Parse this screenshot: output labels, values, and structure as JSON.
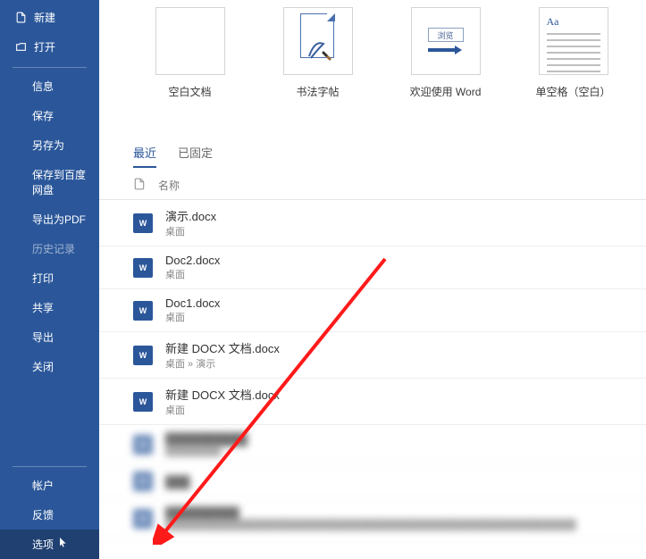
{
  "sidebar": {
    "top": [
      {
        "icon": "new-icon",
        "label": "新建"
      },
      {
        "icon": "open-icon",
        "label": "打开"
      }
    ],
    "mid": [
      {
        "label": "信息"
      },
      {
        "label": "保存"
      },
      {
        "label": "另存为"
      },
      {
        "label": "保存到百度网盘"
      },
      {
        "label": "导出为PDF"
      },
      {
        "label": "历史记录",
        "disabled": true
      },
      {
        "label": "打印"
      },
      {
        "label": "共享"
      },
      {
        "label": "导出"
      },
      {
        "label": "关闭"
      }
    ],
    "bottom": [
      {
        "label": "帐户"
      },
      {
        "label": "反馈"
      },
      {
        "label": "选项",
        "selected": true,
        "cursor": true
      }
    ]
  },
  "templates": [
    {
      "id": "blank",
      "label": "空白文档",
      "thumb": "blank"
    },
    {
      "id": "callig",
      "label": "书法字帖",
      "thumb": "callig"
    },
    {
      "id": "tour",
      "label": "欢迎使用 Word",
      "thumb": "tour",
      "tour_text": "浏览"
    },
    {
      "id": "single",
      "label": "单空格（空白）",
      "thumb": "single",
      "aa": "Aa"
    }
  ],
  "tabs": [
    {
      "id": "recent",
      "label": "最近",
      "active": true
    },
    {
      "id": "pinned",
      "label": "已固定"
    }
  ],
  "list_header": {
    "name_col": "名称"
  },
  "recent_files": [
    {
      "name": "演示.docx",
      "loc": "桌面"
    },
    {
      "name": "Doc2.docx",
      "loc": "桌面"
    },
    {
      "name": "Doc1.docx",
      "loc": "桌面"
    },
    {
      "name": "新建 DOCX 文档.docx",
      "loc": "桌面 » 演示"
    },
    {
      "name": "新建 DOCX 文档.docx",
      "loc": "桌面"
    },
    {
      "name": "██████████",
      "loc": "████████",
      "blur": true
    },
    {
      "name": "███",
      "loc": "",
      "blur": true
    },
    {
      "name": "█████████",
      "loc": "███████████████████████████████████████████████████████████",
      "blur": true
    }
  ]
}
